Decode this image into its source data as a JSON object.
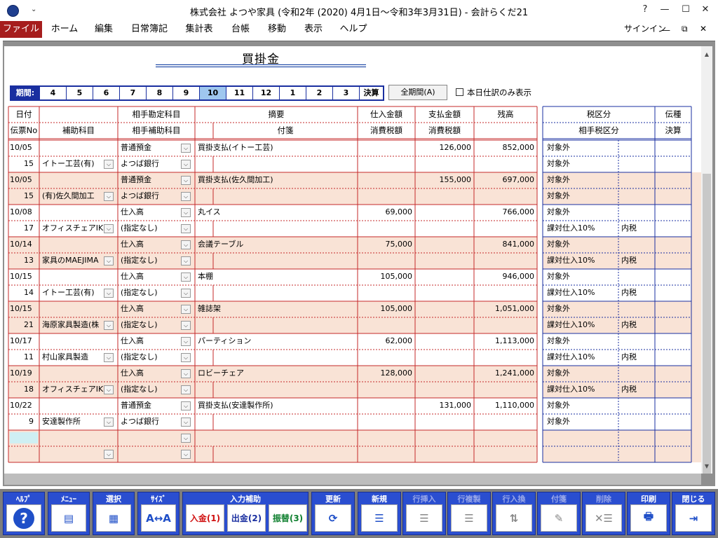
{
  "window": {
    "title": "株式会社 よつや家具 (令和2年 (2020) 4月1日～令和3年3月31日) - 会計らくだ21",
    "help": "?",
    "minimize": "—",
    "maximize": "☐",
    "close": "✕",
    "qa": "⌄"
  },
  "menu": {
    "items": [
      "ファイル",
      "ホーム",
      "編集",
      "日常簿記",
      "集計表",
      "台帳",
      "移動",
      "表示",
      "ヘルプ"
    ],
    "signin": "サインイン",
    "restore": "⧉",
    "min": "—",
    "close": "✕"
  },
  "page": {
    "title": "買掛金"
  },
  "period": {
    "label": "期間:",
    "months": [
      "4",
      "5",
      "6",
      "7",
      "8",
      "9",
      "10",
      "11",
      "12",
      "1",
      "2",
      "3"
    ],
    "final": "決算",
    "selected": "10"
  },
  "all_period_label": "全期間(A)",
  "today_only_label": "本日仕訳のみ表示",
  "headers": {
    "row1": [
      "日付",
      "",
      "相手勘定科目",
      "摘要",
      "仕入金額",
      "支払金額",
      "残高",
      "税区分",
      "伝種"
    ],
    "row2": [
      "伝票No",
      "補助科目",
      "相手補助科目",
      "付箋",
      "消費税額",
      "消費税額",
      "",
      "相手税区分",
      "決算"
    ]
  },
  "rows": [
    {
      "date": "10/05",
      "no": "15",
      "sub": "イトー工芸(有)",
      "acct": "普通預金",
      "acct_sub": "よつば銀行",
      "desc": "買掛支払(イトー工芸)",
      "purchase": "",
      "payment": "126,000",
      "balance": "852,000",
      "tax1": "対象外",
      "tax2": "対象外",
      "tax2b": ""
    },
    {
      "date": "10/05",
      "no": "15",
      "sub": "(有)佐久間加工",
      "acct": "普通預金",
      "acct_sub": "よつば銀行",
      "desc": "買掛支払(佐久間加工)",
      "purchase": "",
      "payment": "155,000",
      "balance": "697,000",
      "tax1": "対象外",
      "tax2": "対象外",
      "tax2b": ""
    },
    {
      "date": "10/08",
      "no": "17",
      "sub": "オフィスチェアIKE",
      "acct": "仕入高",
      "acct_sub": "(指定なし)",
      "desc": "丸イス",
      "purchase": "69,000",
      "payment": "",
      "balance": "766,000",
      "tax1": "対象外",
      "tax2": "課対仕入10%",
      "tax2b": "内税"
    },
    {
      "date": "10/14",
      "no": "13",
      "sub": "家具のMAEJIMA",
      "acct": "仕入高",
      "acct_sub": "(指定なし)",
      "desc": "会議テーブル",
      "purchase": "75,000",
      "payment": "",
      "balance": "841,000",
      "tax1": "対象外",
      "tax2": "課対仕入10%",
      "tax2b": "内税"
    },
    {
      "date": "10/15",
      "no": "14",
      "sub": "イトー工芸(有)",
      "acct": "仕入高",
      "acct_sub": "(指定なし)",
      "desc": "本棚",
      "purchase": "105,000",
      "payment": "",
      "balance": "946,000",
      "tax1": "対象外",
      "tax2": "課対仕入10%",
      "tax2b": "内税"
    },
    {
      "date": "10/15",
      "no": "21",
      "sub": "海原家具製造(株",
      "acct": "仕入高",
      "acct_sub": "(指定なし)",
      "desc": "雑誌架",
      "purchase": "105,000",
      "payment": "",
      "balance": "1,051,000",
      "tax1": "対象外",
      "tax2": "課対仕入10%",
      "tax2b": "内税"
    },
    {
      "date": "10/17",
      "no": "11",
      "sub": "村山家具製造",
      "acct": "仕入高",
      "acct_sub": "(指定なし)",
      "desc": "パーティション",
      "purchase": "62,000",
      "payment": "",
      "balance": "1,113,000",
      "tax1": "対象外",
      "tax2": "課対仕入10%",
      "tax2b": "内税"
    },
    {
      "date": "10/19",
      "no": "18",
      "sub": "オフィスチェアIKE",
      "acct": "仕入高",
      "acct_sub": "(指定なし)",
      "desc": "ロビーチェア",
      "purchase": "128,000",
      "payment": "",
      "balance": "1,241,000",
      "tax1": "対象外",
      "tax2": "課対仕入10%",
      "tax2b": "内税"
    },
    {
      "date": "10/22",
      "no": "9",
      "sub": "安達製作所",
      "acct": "普通預金",
      "acct_sub": "よつば銀行",
      "desc": "買掛支払(安達製作所)",
      "purchase": "",
      "payment": "131,000",
      "balance": "1,110,000",
      "tax1": "対象外",
      "tax2": "対象外",
      "tax2b": ""
    }
  ],
  "toolbar": [
    {
      "label": "ﾍﾙﾌﾟ",
      "icon": "?",
      "name": "help"
    },
    {
      "label": "ﾒﾆｭｰ",
      "icon": "▤",
      "name": "menu"
    },
    {
      "label": "選択",
      "icon": "▦",
      "name": "select"
    },
    {
      "label": "ｻｲｽﾞ",
      "icon": "A↔A",
      "name": "size"
    },
    {
      "label": "入力補助",
      "name": "input-assist"
    },
    {
      "label": "更新",
      "icon": "⟳",
      "name": "refresh"
    },
    {
      "label": "新規",
      "icon": "☰",
      "name": "new"
    },
    {
      "label": "行挿入",
      "icon": "☰",
      "name": "insert-row"
    },
    {
      "label": "行複製",
      "icon": "☰",
      "name": "duplicate-row"
    },
    {
      "label": "行入換",
      "icon": "⇅",
      "name": "swap-row"
    },
    {
      "label": "付箋",
      "icon": "✎",
      "name": "sticky"
    },
    {
      "label": "削除",
      "icon": "✕☰",
      "name": "delete"
    },
    {
      "label": "印刷",
      "icon": "🖶",
      "name": "print"
    },
    {
      "label": "閉じる",
      "icon": "⇥",
      "name": "close"
    }
  ],
  "assist": {
    "in": "入金(1)",
    "out": "出金(2)",
    "transfer": "振替(3)"
  }
}
